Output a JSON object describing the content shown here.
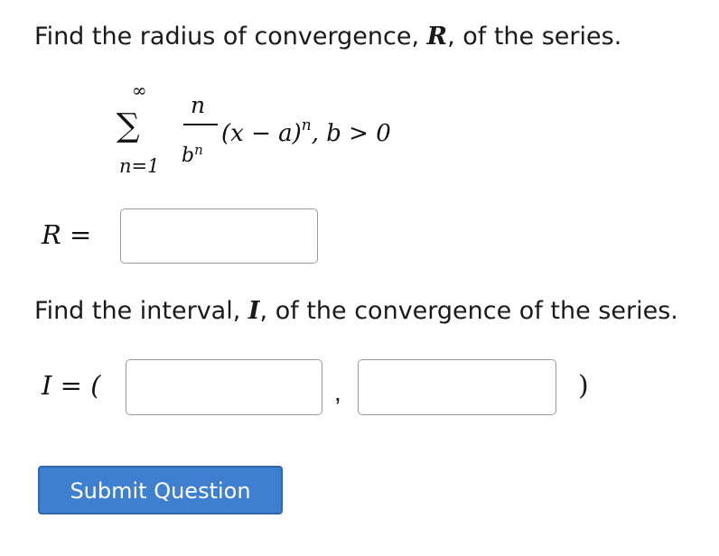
{
  "question_1": {
    "text_before": "Find the radius of convergence, ",
    "variable": "R",
    "text_after": ", of the series."
  },
  "series": {
    "sigma": "∑",
    "upper_limit": "∞",
    "lower_limit": "n=1",
    "numerator": "n",
    "denominator_base": "b",
    "denominator_exp": "n",
    "body_open": "(x − a)",
    "body_exp": "n",
    "condition": ",  b > 0"
  },
  "radius_answer": {
    "label": "R =",
    "value": "",
    "placeholder": ""
  },
  "question_2": {
    "text_before": "Find the interval, ",
    "variable": "I",
    "text_after": ", of the convergence of the series."
  },
  "interval_answer": {
    "label": "I = (",
    "lower_value": "",
    "separator": ",",
    "upper_value": "",
    "close": ")"
  },
  "submit_label": "Submit Question",
  "colors": {
    "button_bg": "#3f7fd0",
    "button_border": "#2f66ad",
    "input_border": "#9a9a9a"
  }
}
